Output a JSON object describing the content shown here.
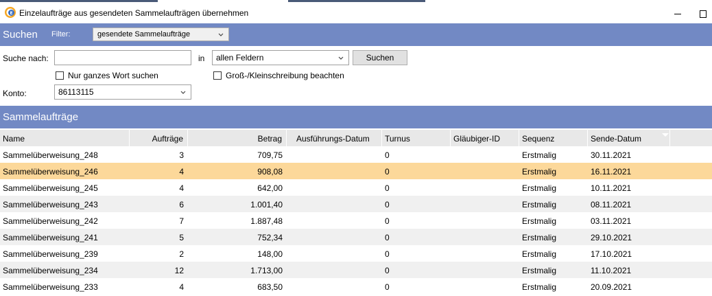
{
  "window": {
    "title": "Einzelaufträge aus gesendeten Sammelaufträgen übernehmen",
    "accent_color": "#7289c4",
    "selected_row_color": "#fcd89a"
  },
  "icons": {
    "app": "app-logo-icon",
    "minimize": "minimize-icon",
    "maximize": "maximize-icon",
    "dropdown": "chevron-down-icon",
    "sort": "sort-descending-icon"
  },
  "search_header": {
    "title": "Suchen",
    "filter_label": "Filter:",
    "filter_value": "gesendete Sammelaufträge"
  },
  "search_panel": {
    "search_label": "Suche nach:",
    "search_value": "",
    "in_label": "in",
    "field_value": "allen Feldern",
    "search_button": "Suchen",
    "whole_word_label": "Nur ganzes Wort suchen",
    "whole_word_checked": false,
    "case_label": "Groß-/Kleinschreibung beachten",
    "case_checked": false,
    "account_label": "Konto:",
    "account_value": "86113115"
  },
  "section": {
    "title": "Sammelaufträge"
  },
  "table": {
    "columns": [
      "Name",
      "Aufträge",
      "Betrag",
      "Ausführungs-Datum",
      "Turnus",
      "Gläubiger-ID",
      "Sequenz",
      "Sende-Datum"
    ],
    "sorted_column": "Sende-Datum",
    "sort_direction": "descending",
    "selected_row": 1,
    "rows": [
      [
        "Sammelüberweisung_248",
        "3",
        "709,75",
        "",
        "0",
        "",
        "Erstmalig",
        "30.11.2021"
      ],
      [
        "Sammelüberweisung_246",
        "4",
        "908,08",
        "",
        "0",
        "",
        "Erstmalig",
        "16.11.2021"
      ],
      [
        "Sammelüberweisung_245",
        "4",
        "642,00",
        "",
        "0",
        "",
        "Erstmalig",
        "10.11.2021"
      ],
      [
        "Sammelüberweisung_243",
        "6",
        "1.001,40",
        "",
        "0",
        "",
        "Erstmalig",
        "08.11.2021"
      ],
      [
        "Sammelüberweisung_242",
        "7",
        "1.887,48",
        "",
        "0",
        "",
        "Erstmalig",
        "03.11.2021"
      ],
      [
        "Sammelüberweisung_241",
        "5",
        "752,34",
        "",
        "0",
        "",
        "Erstmalig",
        "29.10.2021"
      ],
      [
        "Sammelüberweisung_239",
        "2",
        "148,00",
        "",
        "0",
        "",
        "Erstmalig",
        "17.10.2021"
      ],
      [
        "Sammelüberweisung_234",
        "12",
        "1.713,00",
        "",
        "0",
        "",
        "Erstmalig",
        "11.10.2021"
      ],
      [
        "Sammelüberweisung_233",
        "4",
        "683,50",
        "",
        "0",
        "",
        "Erstmalig",
        "20.09.2021"
      ]
    ]
  }
}
